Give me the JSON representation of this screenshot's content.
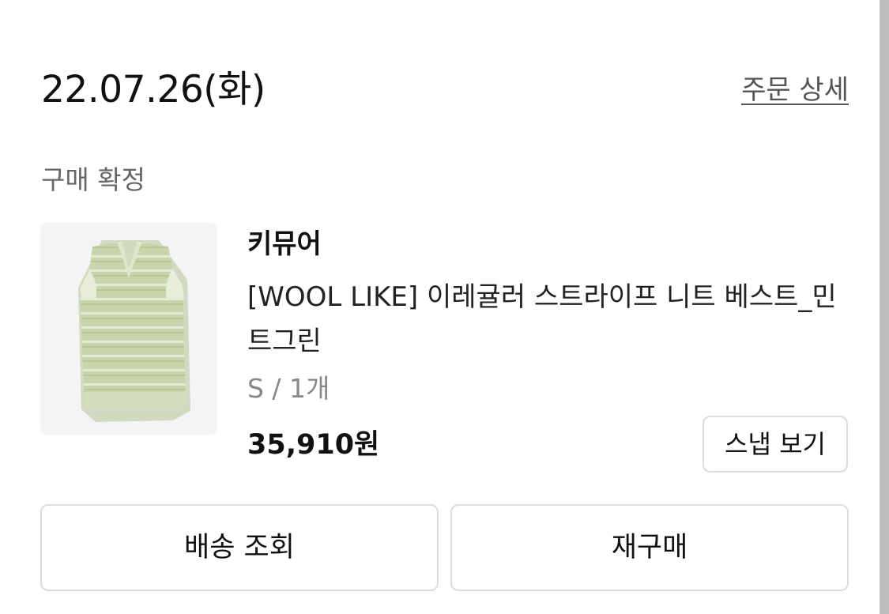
{
  "order": {
    "date": "22.07.26(화)",
    "detail_link": "주문 상세",
    "status": "구매 확정"
  },
  "product": {
    "image_icon": "knit-vest-image",
    "image_color": "#c9d5ad",
    "brand": "키뮤어",
    "name": "[WOOL LIKE] 이레귤러 스트라이프 니트 베스트_민트그린",
    "option": "S / 1개",
    "price": "35,910원",
    "snap_button": "스냅 보기"
  },
  "actions": {
    "delivery_label": "배송 조회",
    "reorder_label": "재구매"
  }
}
